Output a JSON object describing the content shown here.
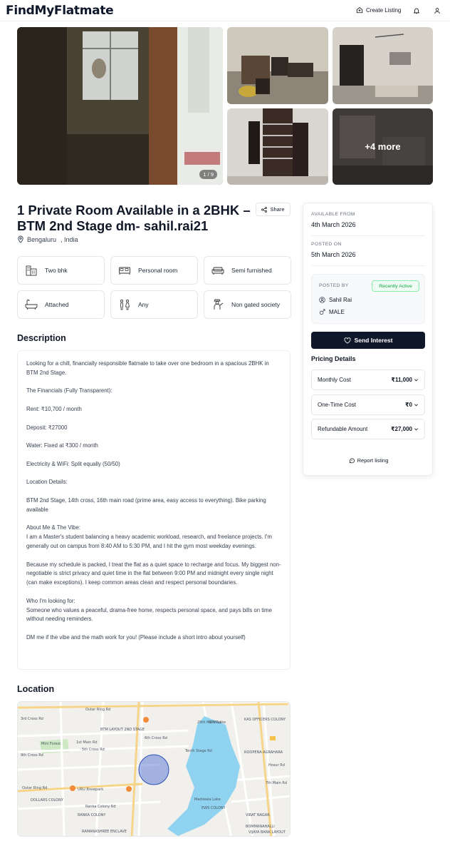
{
  "header": {
    "logo": "FindMyFlatmate",
    "create_listing": "Create Listing",
    "icons": [
      "home-plus-icon",
      "bell-icon",
      "user-icon"
    ]
  },
  "gallery": {
    "counter": "1 / 9",
    "more_label": "+4 more"
  },
  "listing": {
    "title": "1 Private Room Available in a 2BHK – BTM 2nd Stage dm- sahil.rai21",
    "share_label": "Share",
    "city": "Bengaluru",
    "country": ", India"
  },
  "features": [
    {
      "icon": "building-icon",
      "label": "Two bhk"
    },
    {
      "icon": "bed-icon",
      "label": "Personal room"
    },
    {
      "icon": "sofa-icon",
      "label": "Semi furnished"
    },
    {
      "icon": "bathtub-icon",
      "label": "Attached"
    },
    {
      "icon": "people-icon",
      "label": "Any"
    },
    {
      "icon": "security-guard-icon",
      "label": "Non gated society"
    }
  ],
  "description": {
    "heading": "Description",
    "text": "Looking for a chill, financially responsible flatmate to take over one bedroom in a spacious 2BHK in BTM 2nd Stage.\n\nThe Financials (Fully Transparent):\n\nRent: ₹10,700 / month\n\nDeposit: ₹27000\n\nWater: Fixed at ₹300 / month\n\nElectricity & WiFi: Split equally (50/50)\n\nLocation Details:\n\nBTM 2nd Stage, 14th cross, 16th main road (prime area, easy access to everything). Bike parking available\n\nAbout Me & The Vibe:\nI am a Master's student balancing a heavy academic workload, research, and freelance projects. I'm generally out on campus from 8:40 AM to 5:30 PM, and I hit the gym most weekday evenings.\n\nBecause my schedule is packed, I treat the flat as a quiet space to recharge and focus. My biggest non-negotiable is strict privacy and quiet time in the flat between 9:00 PM and midnight every single night (can make exceptions). I keep common areas clean and respect personal boundaries.\n\nWho I'm looking for:\nSomeone who values a peaceful, drama-free home, respects personal space, and pays bills on time without needing reminders.\n\nDM me if the vibe and the math work for you! (Please include a short intro about yourself)"
  },
  "location": {
    "heading": "Location",
    "map_labels": [
      "Outer Ring Rd",
      "6th Cross Rd",
      "5th Cross Rd",
      "3rd Cross Rd",
      "9th Cross Rd",
      "Mini Forest",
      "1st Main Rd",
      "BTM LAYOUT 2ND STAGE",
      "Outer Ring Rd",
      "URU Brewpark",
      "DOLLARS COLONY",
      "Ranka Colony Rd",
      "RANKA COLONY",
      "RAMANASHREE ENCLAVE",
      "BTM Lake",
      "29th Main Rd",
      "Tenth Stage Rd",
      "Madiwala Lake",
      "KAS OFFICERS COLONY",
      "ROOPENA AGRAHARA",
      "VIRAT NAGAR",
      "BOMMANAHALLI",
      "VIJAYA BANK LAYOUT",
      "Hosur Rd",
      "7th Main Rd",
      "EWS COLONY"
    ]
  },
  "sidebar": {
    "available_from_label": "AVAILABLE FROM",
    "available_from": "4th March 2026",
    "posted_on_label": "POSTED ON",
    "posted_on": "5th March 2026",
    "posted_by_label": "POSTED BY",
    "activity_badge": "Recently Active",
    "poster_name": "Sahil Rai",
    "poster_gender": "MALE",
    "send_interest": "Send Interest",
    "pricing_heading": "Pricing Details",
    "pricing": [
      {
        "label": "Monthly Cost",
        "amount": "₹11,000"
      },
      {
        "label": "One-Time Cost",
        "amount": "₹0"
      },
      {
        "label": "Refundable Amount",
        "amount": "₹27,000"
      }
    ],
    "report": "Report listing"
  }
}
